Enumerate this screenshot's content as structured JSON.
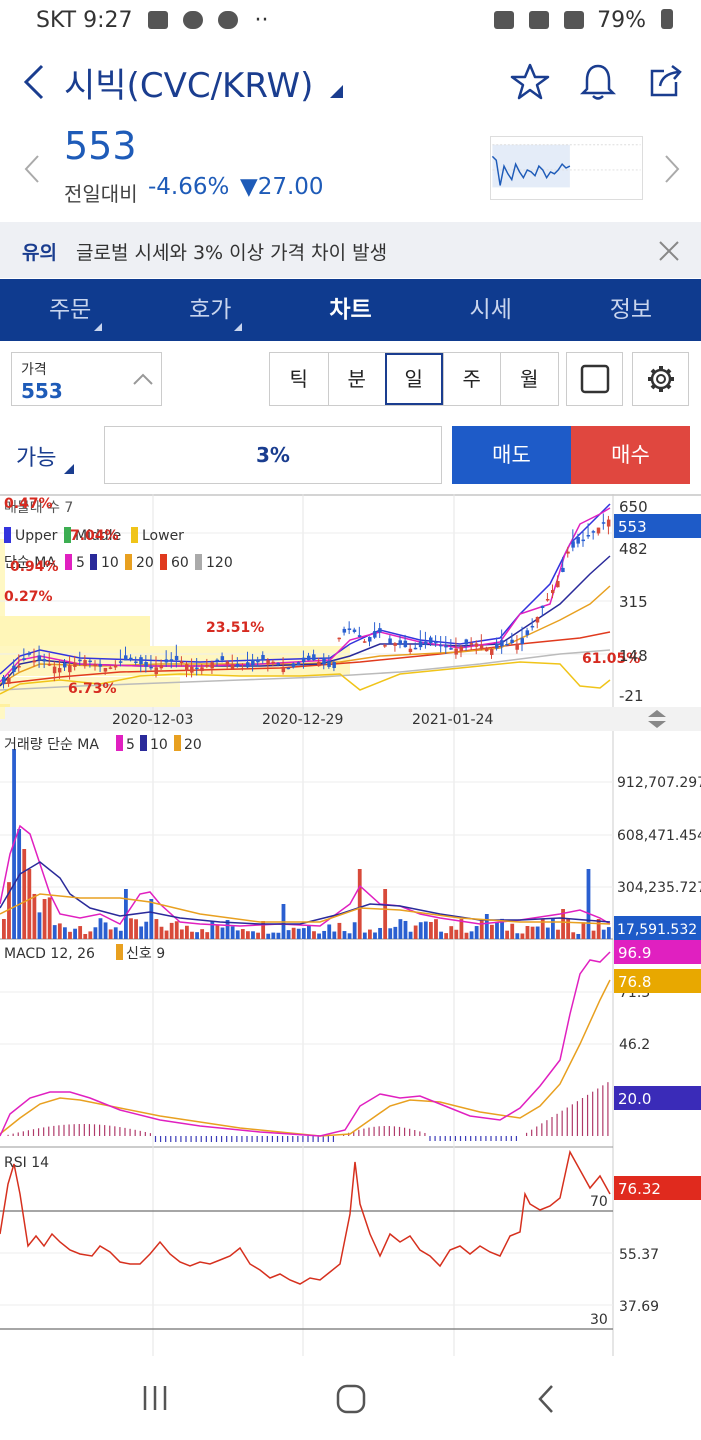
{
  "status_bar": {
    "carrier": "SKT",
    "time": "9:27",
    "dots": "··",
    "battery": "79%"
  },
  "header": {
    "title": "시빅(CVC/KRW)",
    "colors": {
      "brand": "#0f3b8f",
      "down": "#1e5bb8",
      "up": "#e0473f"
    }
  },
  "quote": {
    "price": "553",
    "change_label": "전일대비",
    "change_pct": "-4.66%",
    "change_amt": "▼27.00"
  },
  "notice": {
    "tag": "유의",
    "message": "글로벌 시세와 3% 이상 가격 차이 발생"
  },
  "tabs": [
    {
      "label": "주문"
    },
    {
      "label": "호가"
    },
    {
      "label": "차트"
    },
    {
      "label": "시세"
    },
    {
      "label": "정보"
    }
  ],
  "controls": {
    "price_label": "가격",
    "price_value": "553",
    "periods": [
      "틱",
      "분",
      "일",
      "주",
      "월"
    ],
    "active_period": "일",
    "avail_label": "가능",
    "pct_value": "3%",
    "sell_label": "매도",
    "buy_label": "매수"
  },
  "chart_data": [
    {
      "type": "candlestick",
      "legend_line1": "매물대 수 7",
      "legend_bb": [
        "Upper",
        "Middle",
        "Lower"
      ],
      "legend_ma_label": "단순 MA",
      "legend_ma": [
        "5",
        "10",
        "20",
        "60",
        "120"
      ],
      "annotations": [
        "0.47%",
        "7.04%",
        "0.94%",
        "0.27%",
        "23.51%",
        "6.73%",
        "61.05%"
      ],
      "y_ticks": [
        "650",
        "482",
        "315",
        "148",
        "-21"
      ],
      "current_price_tag": "553",
      "x_ticks": [
        "2020-12-03",
        "2020-12-29",
        "2021-01-24"
      ],
      "series": [
        {
          "name": "Upper",
          "color": "#3333dd"
        },
        {
          "name": "Middle",
          "color": "#3cae52"
        },
        {
          "name": "Lower",
          "color": "#f0c419"
        }
      ]
    },
    {
      "type": "bar",
      "title": "거래량 단순 MA",
      "legend": [
        "5",
        "10",
        "20"
      ],
      "y_ticks": [
        "912,707.297",
        "608,471.454",
        "304,235.727"
      ],
      "current_value_tag": "17,591.532"
    },
    {
      "type": "line",
      "title": "MACD 12, 26",
      "signal_label": "신호 9",
      "y_ticks": [
        "71.3",
        "46.2"
      ],
      "macd_tag": "96.9",
      "signal_tag": "76.8",
      "hist_tag": "20.0"
    },
    {
      "type": "line",
      "title": "RSI 14",
      "y_ticks": [
        "55.37",
        "37.69"
      ],
      "level_70": "70",
      "level_30": "30",
      "current_tag": "76.32"
    }
  ]
}
